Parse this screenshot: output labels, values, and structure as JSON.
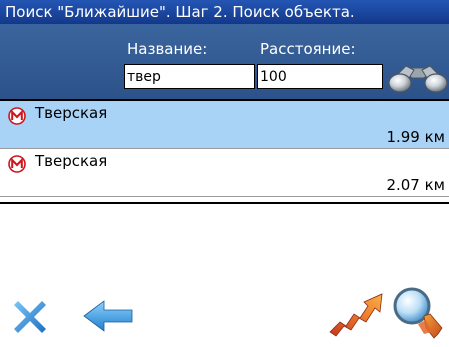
{
  "title": "Поиск \"Ближайшие\". Шаг 2. Поиск объекта.",
  "form": {
    "name_label": "Название:",
    "distance_label": "Расстояние:",
    "name_value": "твер",
    "distance_value": "100"
  },
  "results": [
    {
      "name": "Тверская",
      "distance": "1.99 км",
      "icon": "metro-icon",
      "selected": true
    },
    {
      "name": "Тверская",
      "distance": "2.07 км",
      "icon": "metro-icon",
      "selected": false
    }
  ],
  "toolbar": {
    "close_icon": "close-icon",
    "back_icon": "back-arrow-icon",
    "route_icon": "route-icon",
    "search_icon": "search-magnifier-icon"
  },
  "colors": {
    "titlebar": "#1f4ea8",
    "form_bg": "#34598f",
    "selected_row": "#a8d3f6",
    "close_icon": "#2f8fdc",
    "back_icon": "#3aa0e8",
    "route_icon": "#e0602a"
  }
}
